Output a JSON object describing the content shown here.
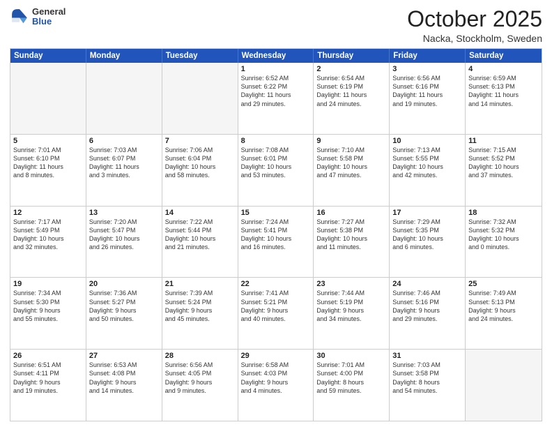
{
  "header": {
    "logo": {
      "general": "General",
      "blue": "Blue"
    },
    "title": "October 2025",
    "location": "Nacka, Stockholm, Sweden"
  },
  "weekdays": [
    "Sunday",
    "Monday",
    "Tuesday",
    "Wednesday",
    "Thursday",
    "Friday",
    "Saturday"
  ],
  "rows": [
    [
      {
        "day": "",
        "empty": true
      },
      {
        "day": "",
        "empty": true
      },
      {
        "day": "",
        "empty": true
      },
      {
        "day": "1",
        "lines": [
          "Sunrise: 6:52 AM",
          "Sunset: 6:22 PM",
          "Daylight: 11 hours",
          "and 29 minutes."
        ]
      },
      {
        "day": "2",
        "lines": [
          "Sunrise: 6:54 AM",
          "Sunset: 6:19 PM",
          "Daylight: 11 hours",
          "and 24 minutes."
        ]
      },
      {
        "day": "3",
        "lines": [
          "Sunrise: 6:56 AM",
          "Sunset: 6:16 PM",
          "Daylight: 11 hours",
          "and 19 minutes."
        ]
      },
      {
        "day": "4",
        "lines": [
          "Sunrise: 6:59 AM",
          "Sunset: 6:13 PM",
          "Daylight: 11 hours",
          "and 14 minutes."
        ]
      }
    ],
    [
      {
        "day": "5",
        "lines": [
          "Sunrise: 7:01 AM",
          "Sunset: 6:10 PM",
          "Daylight: 11 hours",
          "and 8 minutes."
        ]
      },
      {
        "day": "6",
        "lines": [
          "Sunrise: 7:03 AM",
          "Sunset: 6:07 PM",
          "Daylight: 11 hours",
          "and 3 minutes."
        ]
      },
      {
        "day": "7",
        "lines": [
          "Sunrise: 7:06 AM",
          "Sunset: 6:04 PM",
          "Daylight: 10 hours",
          "and 58 minutes."
        ]
      },
      {
        "day": "8",
        "lines": [
          "Sunrise: 7:08 AM",
          "Sunset: 6:01 PM",
          "Daylight: 10 hours",
          "and 53 minutes."
        ]
      },
      {
        "day": "9",
        "lines": [
          "Sunrise: 7:10 AM",
          "Sunset: 5:58 PM",
          "Daylight: 10 hours",
          "and 47 minutes."
        ]
      },
      {
        "day": "10",
        "lines": [
          "Sunrise: 7:13 AM",
          "Sunset: 5:55 PM",
          "Daylight: 10 hours",
          "and 42 minutes."
        ]
      },
      {
        "day": "11",
        "lines": [
          "Sunrise: 7:15 AM",
          "Sunset: 5:52 PM",
          "Daylight: 10 hours",
          "and 37 minutes."
        ]
      }
    ],
    [
      {
        "day": "12",
        "lines": [
          "Sunrise: 7:17 AM",
          "Sunset: 5:49 PM",
          "Daylight: 10 hours",
          "and 32 minutes."
        ]
      },
      {
        "day": "13",
        "lines": [
          "Sunrise: 7:20 AM",
          "Sunset: 5:47 PM",
          "Daylight: 10 hours",
          "and 26 minutes."
        ]
      },
      {
        "day": "14",
        "lines": [
          "Sunrise: 7:22 AM",
          "Sunset: 5:44 PM",
          "Daylight: 10 hours",
          "and 21 minutes."
        ]
      },
      {
        "day": "15",
        "lines": [
          "Sunrise: 7:24 AM",
          "Sunset: 5:41 PM",
          "Daylight: 10 hours",
          "and 16 minutes."
        ]
      },
      {
        "day": "16",
        "lines": [
          "Sunrise: 7:27 AM",
          "Sunset: 5:38 PM",
          "Daylight: 10 hours",
          "and 11 minutes."
        ]
      },
      {
        "day": "17",
        "lines": [
          "Sunrise: 7:29 AM",
          "Sunset: 5:35 PM",
          "Daylight: 10 hours",
          "and 6 minutes."
        ]
      },
      {
        "day": "18",
        "lines": [
          "Sunrise: 7:32 AM",
          "Sunset: 5:32 PM",
          "Daylight: 10 hours",
          "and 0 minutes."
        ]
      }
    ],
    [
      {
        "day": "19",
        "lines": [
          "Sunrise: 7:34 AM",
          "Sunset: 5:30 PM",
          "Daylight: 9 hours",
          "and 55 minutes."
        ]
      },
      {
        "day": "20",
        "lines": [
          "Sunrise: 7:36 AM",
          "Sunset: 5:27 PM",
          "Daylight: 9 hours",
          "and 50 minutes."
        ]
      },
      {
        "day": "21",
        "lines": [
          "Sunrise: 7:39 AM",
          "Sunset: 5:24 PM",
          "Daylight: 9 hours",
          "and 45 minutes."
        ]
      },
      {
        "day": "22",
        "lines": [
          "Sunrise: 7:41 AM",
          "Sunset: 5:21 PM",
          "Daylight: 9 hours",
          "and 40 minutes."
        ]
      },
      {
        "day": "23",
        "lines": [
          "Sunrise: 7:44 AM",
          "Sunset: 5:19 PM",
          "Daylight: 9 hours",
          "and 34 minutes."
        ]
      },
      {
        "day": "24",
        "lines": [
          "Sunrise: 7:46 AM",
          "Sunset: 5:16 PM",
          "Daylight: 9 hours",
          "and 29 minutes."
        ]
      },
      {
        "day": "25",
        "lines": [
          "Sunrise: 7:49 AM",
          "Sunset: 5:13 PM",
          "Daylight: 9 hours",
          "and 24 minutes."
        ]
      }
    ],
    [
      {
        "day": "26",
        "lines": [
          "Sunrise: 6:51 AM",
          "Sunset: 4:11 PM",
          "Daylight: 9 hours",
          "and 19 minutes."
        ]
      },
      {
        "day": "27",
        "lines": [
          "Sunrise: 6:53 AM",
          "Sunset: 4:08 PM",
          "Daylight: 9 hours",
          "and 14 minutes."
        ]
      },
      {
        "day": "28",
        "lines": [
          "Sunrise: 6:56 AM",
          "Sunset: 4:05 PM",
          "Daylight: 9 hours",
          "and 9 minutes."
        ]
      },
      {
        "day": "29",
        "lines": [
          "Sunrise: 6:58 AM",
          "Sunset: 4:03 PM",
          "Daylight: 9 hours",
          "and 4 minutes."
        ]
      },
      {
        "day": "30",
        "lines": [
          "Sunrise: 7:01 AM",
          "Sunset: 4:00 PM",
          "Daylight: 8 hours",
          "and 59 minutes."
        ]
      },
      {
        "day": "31",
        "lines": [
          "Sunrise: 7:03 AM",
          "Sunset: 3:58 PM",
          "Daylight: 8 hours",
          "and 54 minutes."
        ]
      },
      {
        "day": "",
        "empty": true
      }
    ]
  ]
}
